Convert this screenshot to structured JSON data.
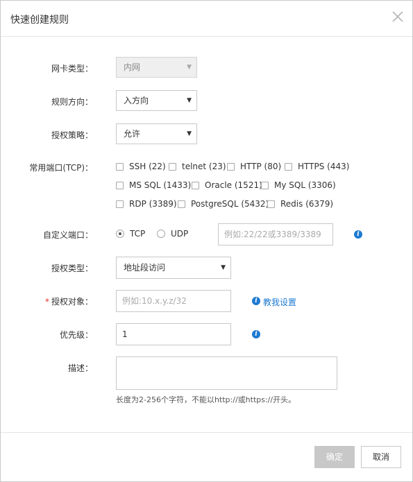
{
  "dialog": {
    "title": "快速创建规则"
  },
  "form": {
    "nic_type": {
      "label": "网卡类型：",
      "value": "内网"
    },
    "direction": {
      "label": "规则方向：",
      "value": "入方向"
    },
    "policy": {
      "label": "授权策略：",
      "value": "允许"
    },
    "common_ports": {
      "label": "常用端口(TCP)：",
      "options": [
        [
          "SSH (22)",
          "telnet (23)",
          "HTTP (80)",
          "HTTPS (443)"
        ],
        [
          "MS SQL (1433)",
          "Oracle (1521)",
          "My SQL (3306)"
        ],
        [
          "RDP (3389)",
          "PostgreSQL (5432)",
          "Redis (6379)"
        ]
      ]
    },
    "custom_port": {
      "label": "自定义端口：",
      "protocols": [
        "TCP",
        "UDP"
      ],
      "selected": "TCP",
      "placeholder": "例如:22/22或3389/3389"
    },
    "auth_type": {
      "label": "授权类型：",
      "value": "地址段访问"
    },
    "auth_object": {
      "required_mark": "*",
      "label": "授权对象：",
      "placeholder": "例如:10.x.y.z/32",
      "help_link": "教我设置"
    },
    "priority": {
      "label": "优先级：",
      "value": "1"
    },
    "description": {
      "label": "描述：",
      "hint": "长度为2-256个字符，不能以http://或https://开头。"
    }
  },
  "footer": {
    "ok_label": "确定",
    "cancel_label": "取消"
  },
  "icons": {
    "close": "close-icon",
    "info": "info-icon",
    "dropdown": "caret-down-icon"
  },
  "colors": {
    "link_blue": "#1e7ad1",
    "required_red": "#e0322f",
    "disabled_button": "#c8c8c8"
  }
}
